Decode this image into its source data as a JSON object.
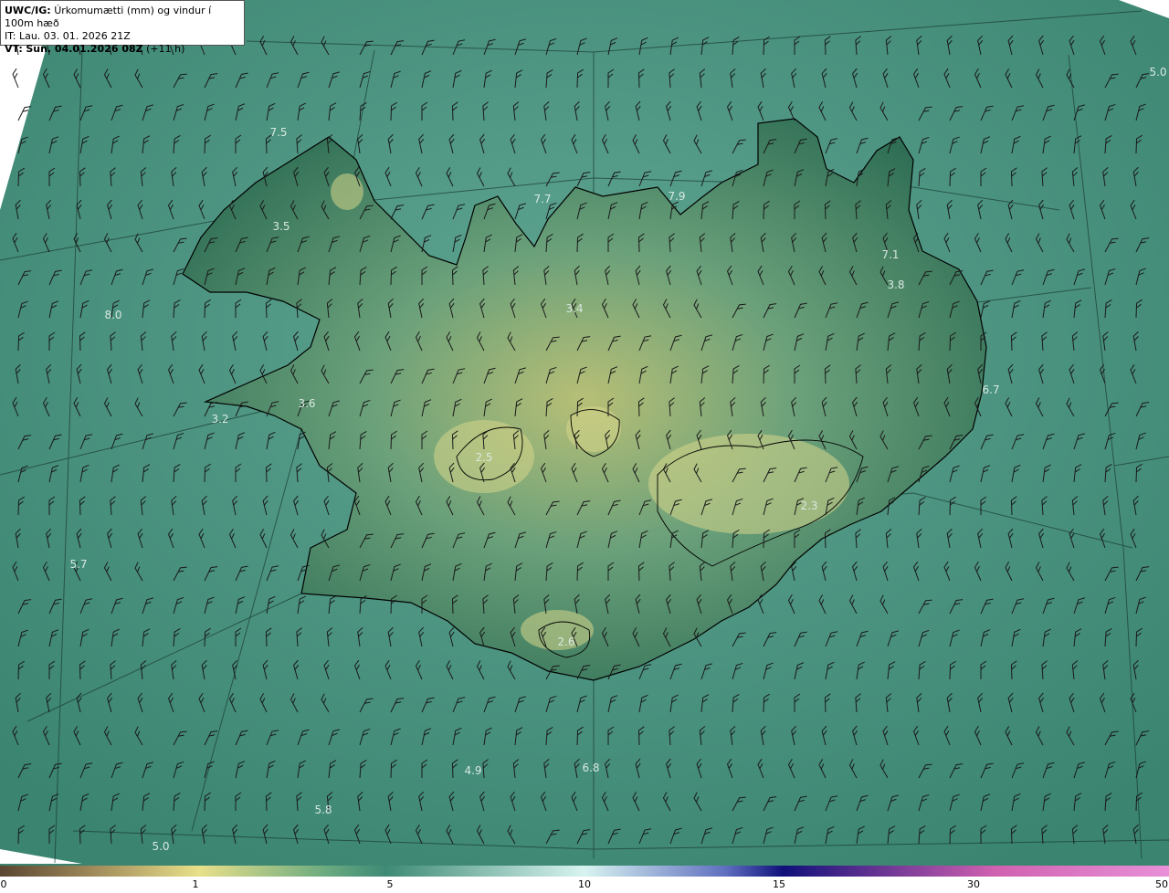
{
  "header": {
    "product": "UWC/IG:",
    "title": "Úrkomumætti (mm) og vindur í 100m hæð",
    "it_line": "IT: Lau. 03. 01. 2026 21Z",
    "vt_prefix": "VT:",
    "vt_date": "Sun. 04.01.2026 08Z",
    "vt_offset": "(+11 h)"
  },
  "map": {
    "land_color": "#2f6e55",
    "sea_color": "#3e8a75",
    "coastline_color": "#000000",
    "value_labels": [
      "5.0",
      "7.5",
      "7.7",
      "7.9",
      "3.5",
      "8.0",
      "3.4",
      "7.1",
      "3.8",
      "3.6",
      "3.2",
      "6.7",
      "2.5",
      "2.3",
      "5.7",
      "2.6",
      "6.8",
      "4.9",
      "5.8",
      "5.0"
    ]
  },
  "colorbar": {
    "stops": [
      "#5a4632",
      "#a08a5a",
      "#e8e08a",
      "#6aaa80",
      "#3e8a75",
      "#d8f4f0",
      "#6070c0",
      "#10107a",
      "#d060b0",
      "#e890d8"
    ],
    "tick_labels": [
      "0",
      "1",
      "5",
      "10",
      "15",
      "30",
      "50"
    ]
  }
}
